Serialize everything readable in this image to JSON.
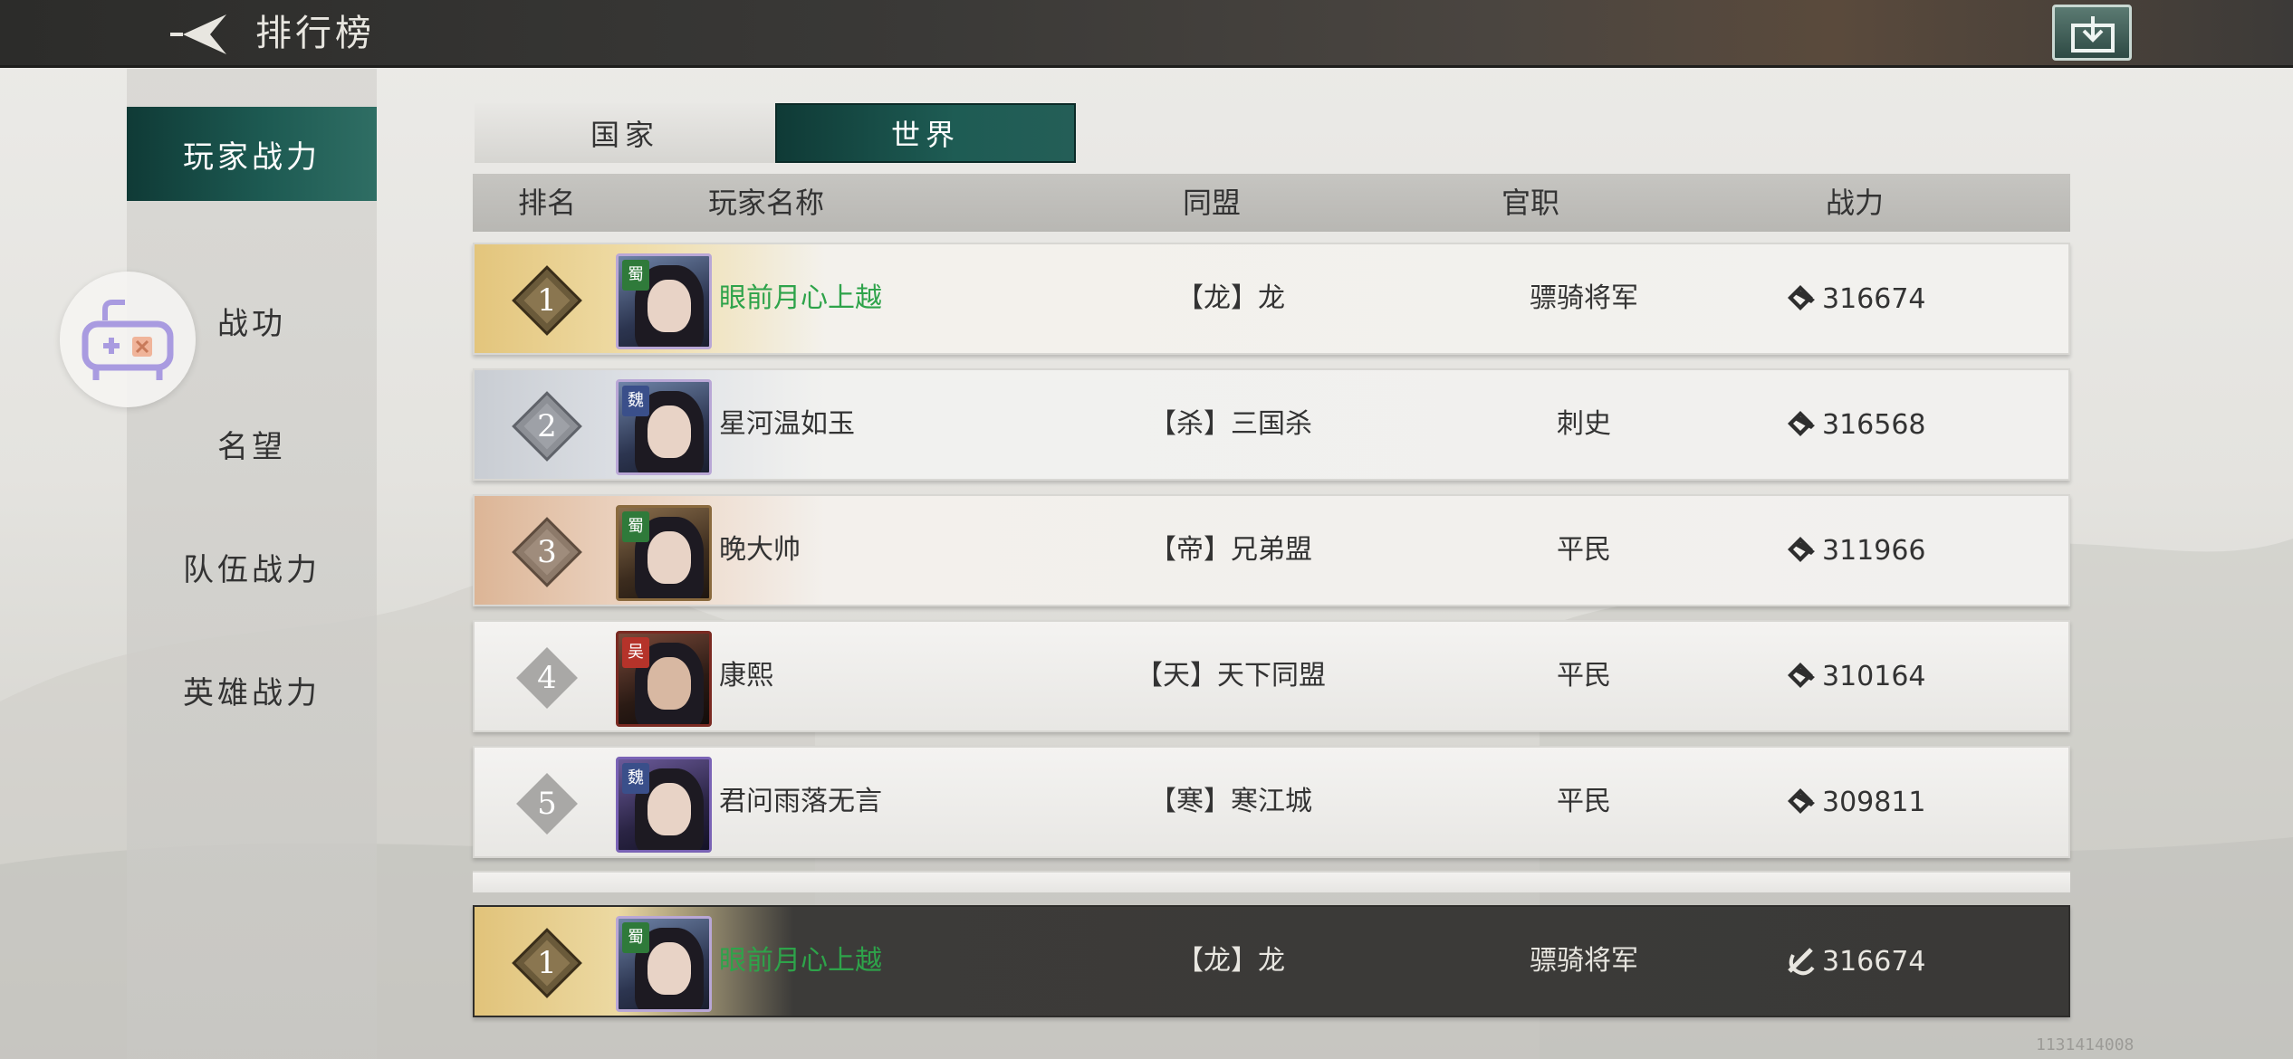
{
  "header": {
    "title": "排行榜"
  },
  "sidebar": {
    "items": [
      {
        "label": "玩家战力",
        "active": true
      },
      {
        "label": "战功",
        "active": false
      },
      {
        "label": "名望",
        "active": false
      },
      {
        "label": "队伍战力",
        "active": false
      },
      {
        "label": "英雄战力",
        "active": false
      }
    ]
  },
  "tabs": [
    {
      "label": "国家",
      "active": false
    },
    {
      "label": "世界",
      "active": true
    }
  ],
  "table": {
    "columns": [
      "排名",
      "玩家名称",
      "同盟",
      "官职",
      "战力"
    ],
    "rows": [
      {
        "rank": "1",
        "faction": "蜀",
        "name": "眼前月心上越",
        "alliance": "【龙】龙",
        "title": "骠骑将军",
        "power": "316674"
      },
      {
        "rank": "2",
        "faction": "魏",
        "name": "星河温如玉",
        "alliance": "【杀】三国杀",
        "title": "刺史",
        "power": "316568"
      },
      {
        "rank": "3",
        "faction": "蜀",
        "name": "晚大帅",
        "alliance": "【帝】兄弟盟",
        "title": "平民",
        "power": "311966"
      },
      {
        "rank": "4",
        "faction": "吴",
        "name": "康熙",
        "alliance": "【天】天下同盟",
        "title": "平民",
        "power": "310164"
      },
      {
        "rank": "5",
        "faction": "魏",
        "name": "君问雨落无言",
        "alliance": "【寒】寒江城",
        "title": "平民",
        "power": "309811"
      }
    ],
    "my_row": {
      "rank": "1",
      "faction": "蜀",
      "name": "眼前月心上越",
      "alliance": "【龙】龙",
      "title": "骠骑将军",
      "power": "316674"
    }
  },
  "watermark": "1131414008",
  "colors": {
    "accent_teal": "#1d5a52",
    "name_green": "#2ea34a",
    "gold": "#e3c57c"
  },
  "icons": {
    "back": "back-arrow-icon",
    "share": "share-icon",
    "gamepad": "gamepad-icon",
    "power": "power-emblem-icon"
  }
}
